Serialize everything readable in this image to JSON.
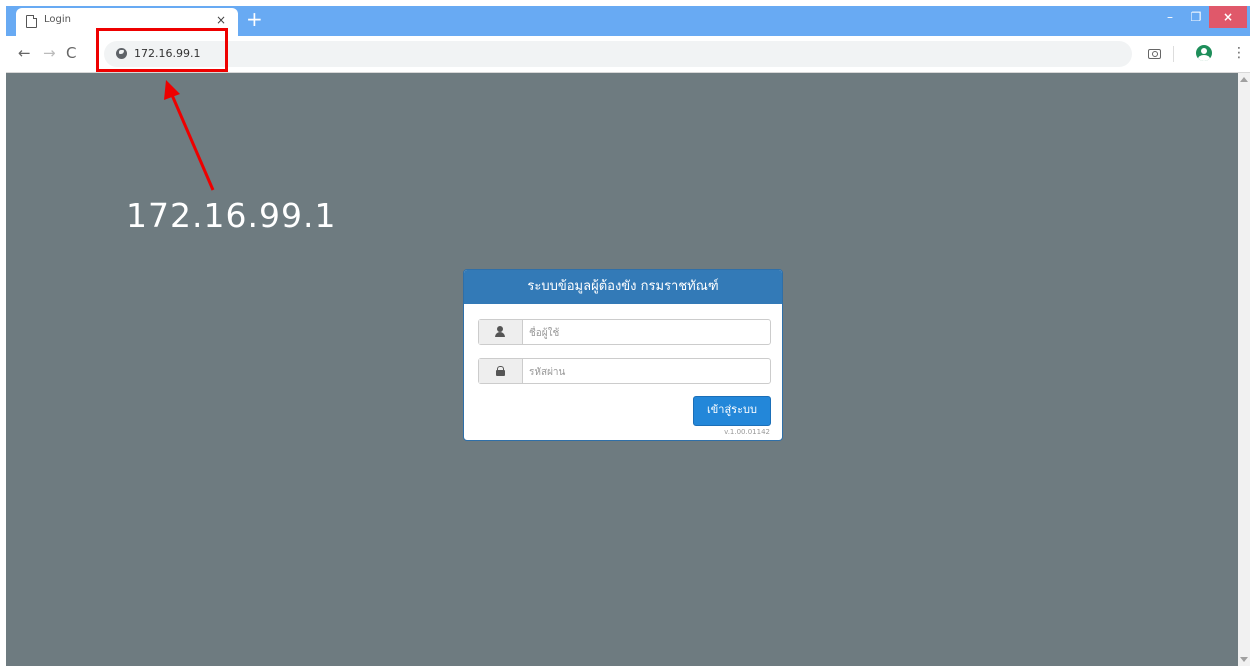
{
  "browser": {
    "tab_title": "Login",
    "tab_close": "×",
    "new_tab": "+",
    "window_controls": {
      "minimize": "–",
      "restore": "❐",
      "close": "×"
    },
    "nav": {
      "back": "←",
      "forward": "→",
      "reload": "C"
    },
    "url": "172.16.99.1",
    "menu": "⋮"
  },
  "login": {
    "title": "ระบบข้อมูลผู้ต้องขัง กรมราชทัณฑ์",
    "username_placeholder": "ชื่อผู้ใช้",
    "password_placeholder": "รหัสผ่าน",
    "submit_label": "เข้าสู่ระบบ",
    "version": "v.1.00.01142"
  },
  "annotation": {
    "label": "172.16.99.1",
    "color": "#ee0000"
  },
  "colors": {
    "page_background": "#6e7b80",
    "tabstrip": "#68aaf3",
    "panel_heading": "#337ab7",
    "login_button": "#2387d9"
  }
}
